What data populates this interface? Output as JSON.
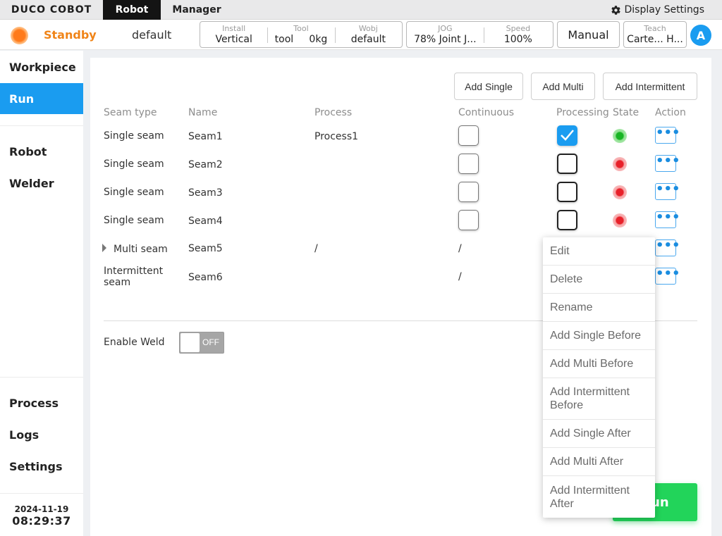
{
  "topbar": {
    "logo": "DUCO COBOT",
    "tabs": [
      "Robot",
      "Manager"
    ],
    "display_settings": "Display Settings",
    "display_settings_icon": "gear-icon"
  },
  "status": {
    "state": "Standby",
    "project": "default",
    "install": {
      "label": "Install",
      "value": "Vertical"
    },
    "tool": {
      "label": "Tool",
      "name": "tool",
      "mass": "0kg"
    },
    "wobj": {
      "label": "Wobj",
      "value": "default"
    },
    "jog": {
      "label": "JOG",
      "value": "78%  Joint J..."
    },
    "speed": {
      "label": "Speed",
      "value": "100%"
    },
    "manual": "Manual",
    "teach": {
      "label": "Teach",
      "value": "Carte... H..."
    },
    "avatar": "A",
    "state_color": "#f08418"
  },
  "sidebar": {
    "items": [
      "Workpiece",
      "Run",
      "Robot",
      "Welder",
      "Process",
      "Logs",
      "Settings"
    ],
    "active": "Run",
    "date": "2024-11-19",
    "time": "08:29:37"
  },
  "main": {
    "buttons": {
      "add_single": "Add Single",
      "add_multi": "Add Multi",
      "add_intermittent": "Add Intermittent"
    },
    "columns": [
      "Seam type",
      "Name",
      "Process",
      "Continuous",
      "Processing",
      "State",
      "Action"
    ],
    "rows": [
      {
        "type": "Single seam",
        "name": "Seam1",
        "process": "Process1",
        "continuous": "",
        "state": "green",
        "processing_checked": true
      },
      {
        "type": "Single seam",
        "name": "Seam2",
        "process": "",
        "continuous": "",
        "state": "red",
        "processing_checked": false
      },
      {
        "type": "Single seam",
        "name": "Seam3",
        "process": "",
        "continuous": "",
        "state": "red",
        "processing_checked": false
      },
      {
        "type": "Single seam",
        "name": "Seam4",
        "process": "",
        "continuous": "",
        "state": "red",
        "processing_checked": false
      },
      {
        "type": "Multi seam",
        "name": "Seam5",
        "process": "/",
        "continuous": "/",
        "state": "",
        "processing_checked": false
      },
      {
        "type": "Intermittent seam",
        "name": "Seam6",
        "process": "",
        "continuous": "/",
        "state": "",
        "processing_checked": false
      }
    ],
    "enable_weld": {
      "label": "Enable Weld",
      "state": "OFF"
    },
    "run_button": "Run"
  },
  "context_menu": {
    "items": [
      "Edit",
      "Delete",
      "Rename",
      "Add Single Before",
      "Add Multi Before",
      "Add Intermittent Before",
      "Add Single After",
      "Add Multi After",
      "Add Intermittent After"
    ]
  },
  "colors": {
    "accent": "#1a9cf0",
    "run": "#22d45a",
    "standby": "#f08418"
  }
}
